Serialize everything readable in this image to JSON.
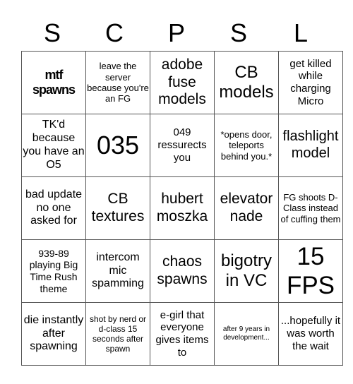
{
  "header": [
    "S",
    "C",
    "P",
    "S",
    "L"
  ],
  "cells": [
    [
      "mtf spawns",
      "leave the server because you're an FG",
      "adobe fuse models",
      "CB models",
      "get killed while charging Micro"
    ],
    [
      "TK'd because you have an O5",
      "035",
      "049 ressurects you",
      "*opens door, teleports behind you.*",
      "flashlight model"
    ],
    [
      "bad update no one asked for",
      "CB textures",
      "hubert moszka",
      "elevator nade",
      "FG shoots D-Class instead of cuffing them"
    ],
    [
      "939-89 playing Big Time Rush theme",
      "intercom mic spamming",
      "chaos spawns",
      "bigotry in VC",
      "15 FPS"
    ],
    [
      "die instantly after spawning",
      "shot by nerd or d-class 15 seconds after spawn",
      "e-girl that everyone gives items to",
      "after 9 years in development...",
      "...hopefully it was worth the wait"
    ]
  ]
}
